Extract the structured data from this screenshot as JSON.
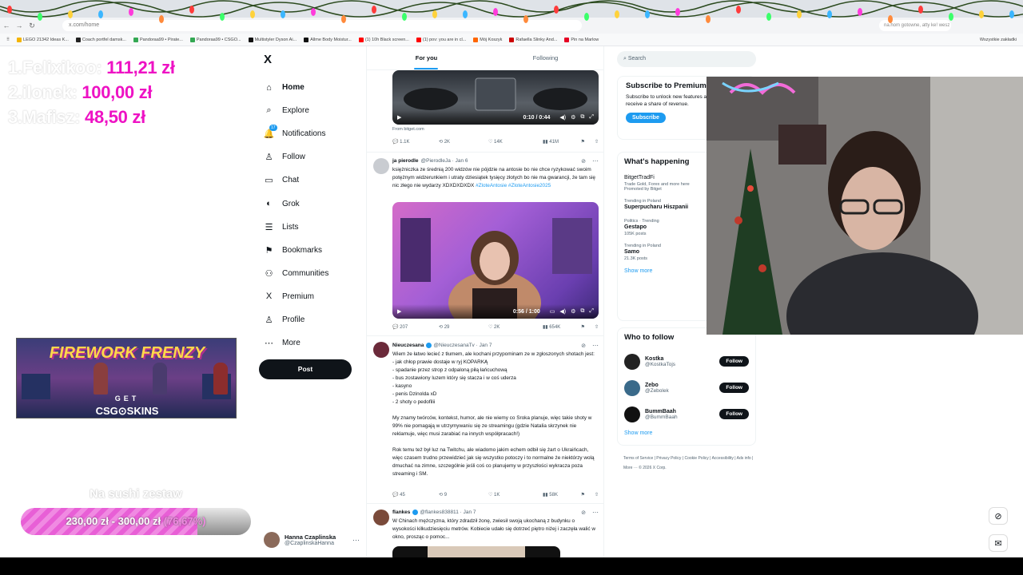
{
  "browser": {
    "url": "x.com/home",
    "url_right": "na.hom gotowne, atty ke! wesz",
    "bookmarks": [
      {
        "label": "LEGO 21342 Ideas K...",
        "color": "#f4b400"
      },
      {
        "label": "Coach portfel damsk...",
        "color": "#222222"
      },
      {
        "label": "Pandoraa99 • Pirate...",
        "color": "#34a853"
      },
      {
        "label": "Pandoraa99 • CSGO...",
        "color": "#34a853"
      },
      {
        "label": "Multistyler Dyson Ai...",
        "color": "#111111"
      },
      {
        "label": "Allme Body Moistur...",
        "color": "#111111"
      },
      {
        "label": "(1) 10h Black screen...",
        "color": "#ff0000"
      },
      {
        "label": "(1) pov: you are in cl...",
        "color": "#ff0000"
      },
      {
        "label": "Mój Koszyk",
        "color": "#ff6600"
      },
      {
        "label": "Rafaella Slinky And...",
        "color": "#cc0000"
      },
      {
        "label": "Pin na Marlow",
        "color": "#e60023"
      }
    ],
    "bookmarks_right": "Wszystkie zakładki"
  },
  "overlay": {
    "leaderboard": [
      {
        "name": "1.Felixikoo:",
        "amount": "111,21 zł"
      },
      {
        "name": "2.ilonek:",
        "amount": "100,00 zł"
      },
      {
        "name": "3.Mafisz:",
        "amount": "48,50 zł"
      }
    ],
    "promo": {
      "title": "FIREWORK FRENZY",
      "get": "GET",
      "brand": "CSG⊙SKINS"
    },
    "goal": {
      "title": "Na sushi zestaw",
      "current": "230,00 zł",
      "separator": "-",
      "target": "300,00 zł",
      "percent_text": "(76,67%)",
      "progress": 0.7667
    }
  },
  "x": {
    "logo": "X",
    "nav": [
      {
        "label": "Home",
        "icon": "⌂",
        "active": true
      },
      {
        "label": "Explore",
        "icon": "⌕"
      },
      {
        "label": "Notifications",
        "icon": "🔔"
      },
      {
        "label": "Follow",
        "icon": "♙"
      },
      {
        "label": "Chat",
        "icon": "▭"
      },
      {
        "label": "Grok",
        "icon": "◐"
      },
      {
        "label": "Lists",
        "icon": "☰"
      },
      {
        "label": "Bookmarks",
        "icon": "⚑"
      },
      {
        "label": "Communities",
        "icon": "⚇"
      },
      {
        "label": "Premium",
        "icon": "X"
      },
      {
        "label": "Profile",
        "icon": "♙"
      },
      {
        "label": "More",
        "icon": "⋯"
      }
    ],
    "notifications_badge": "17",
    "post_button": "Post",
    "account": {
      "name": "Hanna Czaplinska",
      "handle": "@CzaplinskaHanna"
    }
  },
  "feed": {
    "tabs": [
      {
        "label": "For you",
        "active": true
      },
      {
        "label": "Following"
      }
    ],
    "tweet0": {
      "video_time": "0:10 / 0:44",
      "from": "From bitget.com",
      "replies": "1.1K",
      "reposts": "2K",
      "likes": "14K",
      "views": "41M"
    },
    "tweet1": {
      "name": "ja pierodle",
      "handle": "@PierodleJa · Jan 6",
      "text": "księżniczka ze średnią 200 widzów nie pójdzie na antosie bo nie chce ryzykować swoim potężnym widzerunkiem i utraty dziesiątek tysięcy złotych bo nie ma gwarancji, że tam się nic złego nie wydarzy XDXDXDXDX ",
      "tags": "#ZloteAntosie #ZloteAntosie2025",
      "video_time": "0:56 / 1:00",
      "replies": "207",
      "reposts": "29",
      "likes": "2K",
      "views": "654K"
    },
    "tweet2": {
      "name": "Nieuczesana",
      "handle": "@NieuczesanaTv · Jan 7",
      "text": "Wiem że łatwo lecieć z tłumem, ale kochani przypominam ze w zgłoszonych shotach jest:\n- jak chłop prawie dostaje w ryj KOPARKĄ\n- spadanie przez strop z odpaloną piłą łańcuchową\n- bus zostawiony luzem który się stacza i w coś uderza\n- kasyno\n- penis Dzinolda xD\n- 2 shoty o pedofilii\n\nMy znamy twórców, kontekst, humor, ale nie wiemy co Sroka planuje, więc takie shoty w 99% nie pomagają w utrzymywaniu się ze streamingu (gdzie Natalia skrzynek nie reklamuje, więc musi zarabiać na innych współpracach!)\n\nRok temu też był luz na Twitchu, ale wiadomo jakim echem odbił się żart o Ukraińcach, więc czasem trudno przewidzieć jak się wszystko potoczy i to normalne że niektórzy wolą dmuchać na zimne, szczególnie jeśli coś co planujemy w przyszłości wykracza poza streaming i SM.",
      "replies": "45",
      "reposts": "9",
      "likes": "1K",
      "views": "58K"
    },
    "tweet3": {
      "name": "flankes",
      "handle": "@flankes838811 · Jan 7",
      "text": "W Chinach mężczyzna, który zdradził żonę, zwiesił swoją ukochaną z budynku o wysokości kilkudziesięciu metrów. Kobiecie udało się dotrzeć piętro niżej i zaczęła walić w okno, prosząc o pomoc..."
    }
  },
  "sidebar_right": {
    "search_placeholder": "Search",
    "premium": {
      "title": "Subscribe to Premium",
      "desc": "Subscribe to unlock new features and if eligible, receive a share of revenue.",
      "button": "Subscribe"
    },
    "happening": {
      "title": "What's happening",
      "trends": [
        {
          "meta": "",
          "title": "BitgetTradFi",
          "desc": "Trade Gold, Forex and more here",
          "count": "Promoted by Bitget"
        },
        {
          "meta": "Trending in Poland",
          "title": "Superpucharu Hiszpanii",
          "count": ""
        },
        {
          "meta": "Politics · Trending",
          "title": "Gestapo",
          "count": "105K posts"
        },
        {
          "meta": "Trending in Poland",
          "title": "Samo",
          "count": "21.3K posts"
        }
      ],
      "show_more": "Show more"
    },
    "who_to_follow": {
      "title": "Who to follow",
      "users": [
        {
          "name": "Kostka",
          "handle": "@KostkaTojs",
          "button": "Follow"
        },
        {
          "name": "Zebo",
          "handle": "@Zebolek",
          "button": "Follow"
        },
        {
          "name": "BummBaah",
          "handle": "@BummBaah",
          "button": "Follow"
        }
      ],
      "show_more": "Show more"
    },
    "footer": "Terms of Service  |  Privacy Policy  |  Cookie Policy  |  Accessibility  |  Ads info  |  More ···  © 2026 X Corp."
  },
  "colors": {
    "accent": "#1d9bf0",
    "overlay_pink": "#ee12c4"
  }
}
